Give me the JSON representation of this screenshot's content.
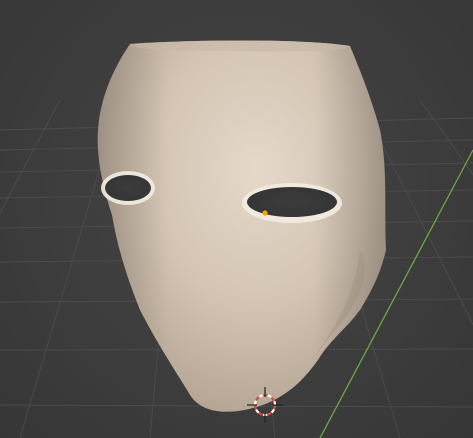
{
  "viewport": {
    "background_color": "#3d3d3d",
    "grid_color": "#4a4a4a",
    "y_axis_color": "#6ea646",
    "object": {
      "name": "mask",
      "color": "#d6c8b8",
      "shadow_color": "#a39483",
      "origin_color": "#ffa500"
    },
    "cursor_3d": {
      "icon": "3d-cursor-icon",
      "ring_colors": [
        "#e04a3a",
        "#ffffff"
      ]
    }
  }
}
